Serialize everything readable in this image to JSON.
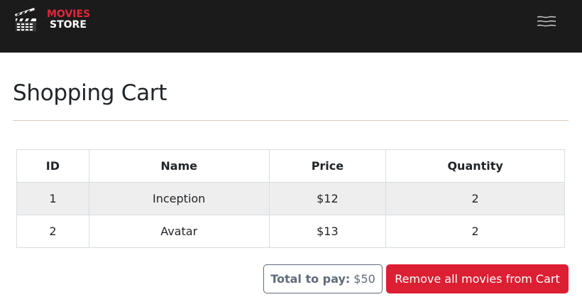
{
  "brand": {
    "line1": "MOVIES",
    "line2": "STORE",
    "logo_icon": "clapperboard-icon",
    "accent_color": "#e3263a"
  },
  "navbar": {
    "menu_icon": "hamburger-menu-icon",
    "background": "#1c1b1b"
  },
  "page": {
    "title": "Shopping Cart"
  },
  "cart": {
    "columns": [
      "ID",
      "Name",
      "Price",
      "Quantity"
    ],
    "rows": [
      {
        "id": "1",
        "name": "Inception",
        "price": "$12",
        "quantity": "2"
      },
      {
        "id": "2",
        "name": "Avatar",
        "price": "$13",
        "quantity": "2"
      }
    ]
  },
  "summary": {
    "total_label": "Total to pay:",
    "total_value": "$50"
  },
  "actions": {
    "remove_all_label": "Remove all movies from Cart",
    "remove_color": "#dc1f33"
  }
}
